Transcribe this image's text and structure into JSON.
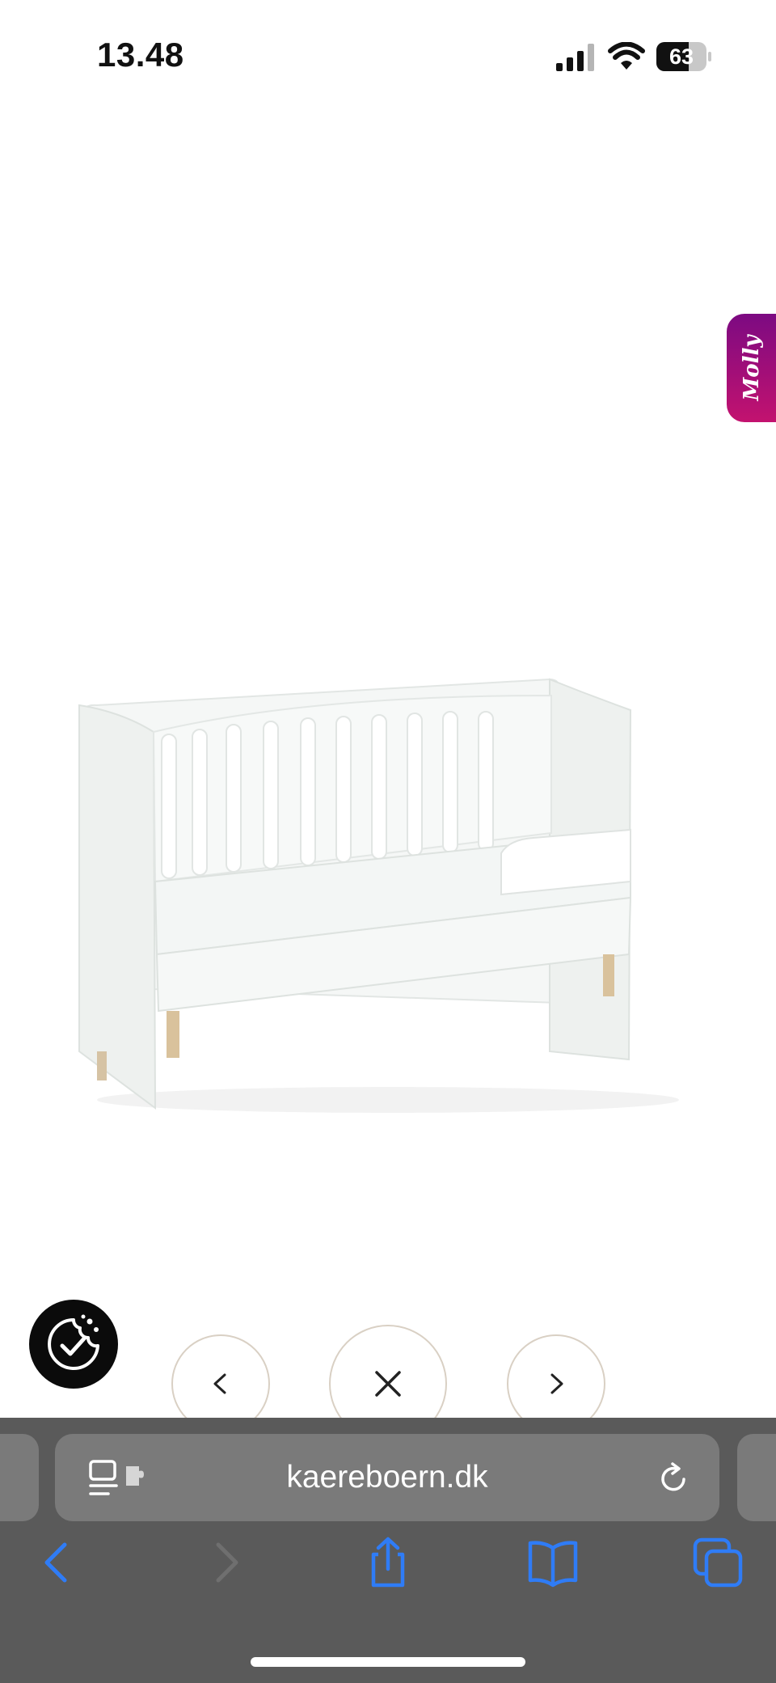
{
  "status_bar": {
    "time": "13.48",
    "battery_level": "63",
    "icons": [
      "signal-icon",
      "wifi-icon",
      "battery-icon"
    ]
  },
  "lightbox": {
    "image_alt": "Hvid tremmeseng med naturfarvede træben",
    "controls": {
      "prev_icon": "chevron-left-icon",
      "close_icon": "close-icon",
      "next_icon": "chevron-right-icon"
    }
  },
  "widgets": {
    "molly_tab_label": "Molly",
    "cookie_icon": "cookie-consent-icon"
  },
  "browser": {
    "url": "kaereboern.dk",
    "icons": {
      "reader": "reader-icon",
      "reload": "reload-icon",
      "back": "back-icon",
      "forward": "forward-icon",
      "share": "share-icon",
      "bookmarks": "bookmarks-icon",
      "tabs": "tabs-icon"
    }
  },
  "colors": {
    "browser_chrome": "#5a5a5a",
    "address_bar": "#7a7a7a",
    "accent_blue": "#2f7cf6",
    "molly_gradient_start": "#7c0a82",
    "molly_gradient_end": "#c3126f",
    "nav_button_border": "#d9d0c4"
  }
}
